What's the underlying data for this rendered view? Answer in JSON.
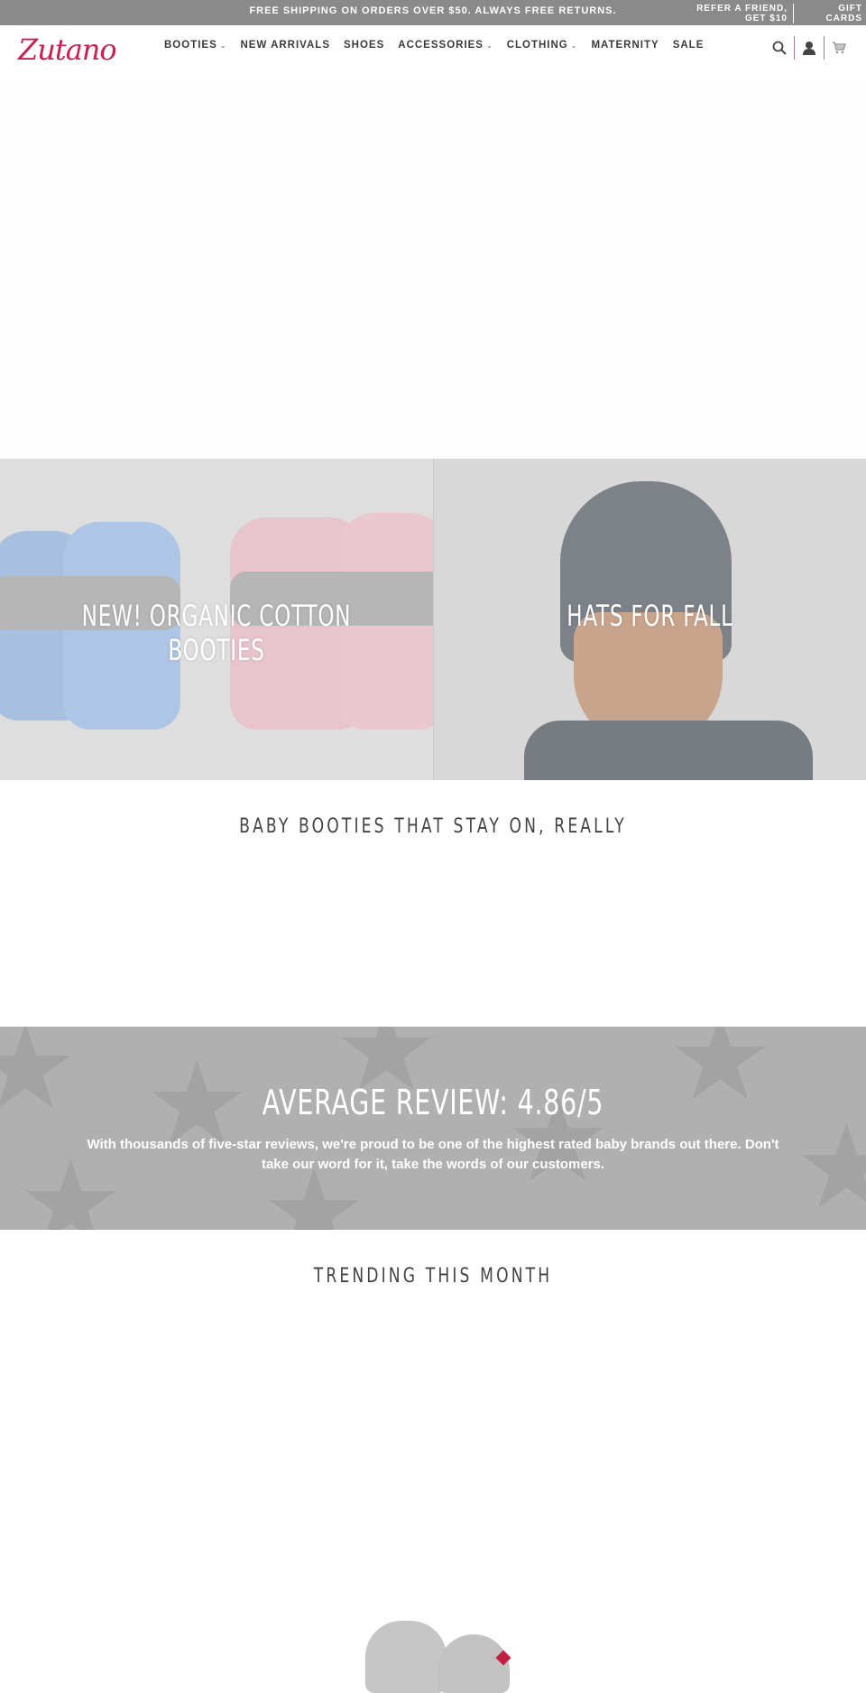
{
  "announcement": {
    "message": "FREE SHIPPING ON ORDERS OVER $50. ALWAYS FREE RETURNS.",
    "refer": "REFER A FRIEND, GET $10",
    "gift_cards": "GIFT CARDS"
  },
  "header": {
    "logo_text": "Zutano",
    "brand_color": "#cc1e52",
    "nav": [
      {
        "label": "BOOTIES",
        "has_dropdown": true
      },
      {
        "label": "NEW ARRIVALS",
        "has_dropdown": false
      },
      {
        "label": "SHOES",
        "has_dropdown": false
      },
      {
        "label": "ACCESSORIES",
        "has_dropdown": true
      },
      {
        "label": "CLOTHING",
        "has_dropdown": true
      },
      {
        "label": "MATERNITY",
        "has_dropdown": false
      },
      {
        "label": "SALE",
        "has_dropdown": false
      }
    ],
    "chevron": "⌄",
    "icons": [
      "search-icon",
      "account-icon",
      "cart-icon"
    ]
  },
  "tiles": [
    {
      "title": "NEW! ORGANIC COTTON BOOTIES"
    },
    {
      "title": "HATS FOR FALL"
    }
  ],
  "sections": {
    "booties_heading": "BABY BOOTIES THAT STAY ON, REALLY",
    "reviews_title": "AVERAGE REVIEW: 4.86/5",
    "reviews_body": "With thousands of five-star reviews, we're proud to be one of the highest rated baby brands out there. Don't take our word for it, take the words of our customers.",
    "trending_heading": "TRENDING THIS MONTH"
  }
}
